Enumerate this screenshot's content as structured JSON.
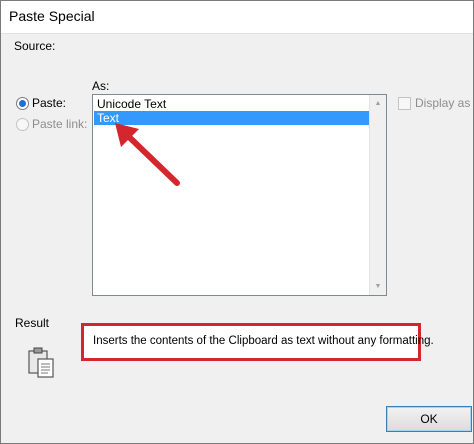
{
  "window": {
    "title": "Paste Special"
  },
  "source": {
    "label": "Source:"
  },
  "as": {
    "label": "As:"
  },
  "options": {
    "paste_label": "Paste:",
    "paste_link_label": "Paste link:"
  },
  "format_list": {
    "items": [
      "Unicode Text",
      "Text"
    ],
    "selected_index": 1
  },
  "display_as_icon": {
    "label": "Display as icon"
  },
  "result": {
    "label": "Result",
    "description": "Inserts the contents of the Clipboard as text without any formatting."
  },
  "buttons": {
    "ok_label": "OK"
  },
  "colors": {
    "selection": "#3399ff",
    "annotation_red": "#d4262d",
    "radio_dot": "#1f6fd6"
  },
  "icons": [
    "clipboard-icon",
    "scroll-up-arrow-icon",
    "scroll-down-arrow-icon"
  ]
}
